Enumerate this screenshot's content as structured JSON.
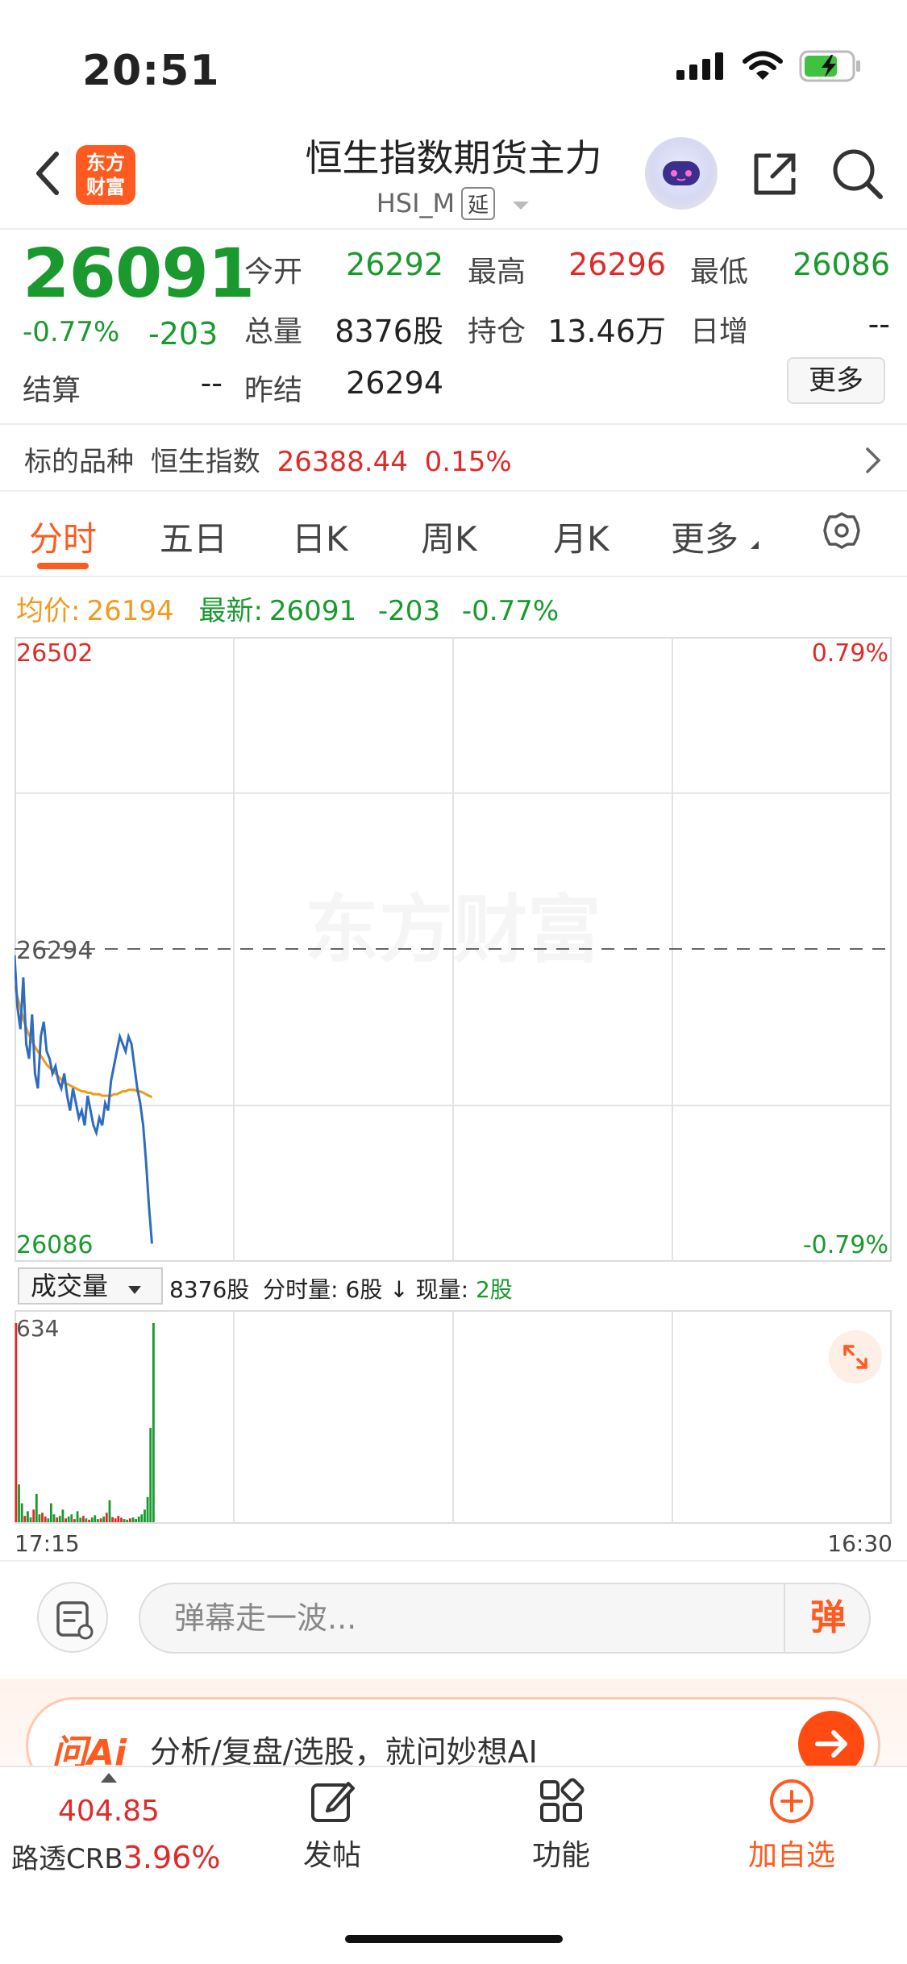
{
  "status": {
    "time": "20:51"
  },
  "header": {
    "logo_line1": "东方",
    "logo_line2": "财富",
    "title": "恒生指数期货主力",
    "code": "HSI_M",
    "delay_tag": "延"
  },
  "quote": {
    "price": "26091",
    "change_pct": "-0.77%",
    "change": "-203",
    "open_label": "今开",
    "open": "26292",
    "high_label": "最高",
    "high": "26296",
    "low_label": "最低",
    "low": "26086",
    "vol_label": "总量",
    "vol": "8376股",
    "oi_label": "持仓",
    "oi": "13.46万",
    "daily_inc_label": "日增",
    "daily_inc": "--",
    "settle_label": "结算",
    "settle": "--",
    "prev_settle_label": "昨结",
    "prev_settle": "26294",
    "more_label": "更多"
  },
  "underlying": {
    "label": "标的品种",
    "name": "恒生指数",
    "value": "26388.44",
    "pct": "0.15%"
  },
  "tabs": [
    "分时",
    "五日",
    "日K",
    "周K",
    "月K",
    "更多"
  ],
  "avg_line": {
    "avg_label": "均价:",
    "avg": "26194",
    "latest_label": "最新:",
    "latest": "26091",
    "latest_chg": "-203",
    "latest_pct": "-0.77%"
  },
  "chart_data": {
    "type": "line",
    "y_max_label": "26502",
    "y_mid_label": "26294",
    "y_min_label": "26086",
    "pct_max_label": "0.79%",
    "pct_min_label": "-0.79%",
    "ylim": [
      26086,
      26502
    ],
    "reference": 26294,
    "watermark": "东方财富",
    "x_start_label": "17:15",
    "x_end_label": "16:30",
    "series": [
      {
        "values": [
          26290,
          26255,
          26240,
          26275,
          26230,
          26220,
          26250,
          26210,
          26200,
          26235,
          26245,
          26225,
          26220,
          26210,
          26215,
          26205,
          26200,
          26210,
          26195,
          26185,
          26200,
          26190,
          26180,
          26185,
          26175,
          26195,
          26185,
          26175,
          26170,
          26180,
          26175,
          26190,
          26185,
          26205,
          26215,
          26225,
          26235,
          26230,
          26225,
          26235,
          26230,
          26215,
          26200,
          26190,
          26175,
          26150,
          26120,
          26095
        ]
      },
      {
        "values": [
          26270,
          26262,
          26254,
          26247,
          26241,
          26236,
          26232,
          26228,
          26225,
          26222,
          26219,
          26216,
          26214,
          26212,
          26210,
          26208,
          26206,
          26204,
          26203,
          26202,
          26201,
          26200,
          26199,
          26198,
          26198,
          26197,
          26197,
          26196,
          26196,
          26196,
          26195,
          26195,
          26195,
          26195,
          26196,
          26196,
          26197,
          26198,
          26198,
          26199,
          26199,
          26199,
          26198,
          26198,
          26197,
          26196,
          26195,
          26194
        ]
      }
    ]
  },
  "volume": {
    "selector": "成交量",
    "total": "8376股",
    "min_label": "分时量:",
    "min_val": "6股",
    "arrow": "↓",
    "now_label": "现量:",
    "now_val": "2股",
    "max_label": "634",
    "bars": [
      634,
      120,
      60,
      20,
      35,
      15,
      40,
      90,
      25,
      30,
      18,
      12,
      60,
      25,
      15,
      20,
      40,
      12,
      18,
      25,
      10,
      35,
      14,
      20,
      12,
      8,
      15,
      22,
      10,
      12,
      18,
      30,
      70,
      16,
      12,
      20,
      14,
      10,
      8,
      12,
      15,
      10,
      18,
      25,
      40,
      80,
      300,
      634
    ]
  },
  "comment": {
    "placeholder": "弹幕走一波...",
    "send": "弹"
  },
  "ai": {
    "logo": "问Ai",
    "text": "分析/复盘/选股，就问妙想AI"
  },
  "bottom": {
    "index_value": "404.85",
    "index_name": "路透CRB",
    "index_pct": "3.96%",
    "nav": [
      "发帖",
      "功能",
      "加自选"
    ]
  },
  "colors": {
    "up": "#e02a2a",
    "down": "#1a9a2e",
    "accent": "#ff5a1f",
    "avg": "#f29a1c",
    "line": "#2f6cc0"
  }
}
